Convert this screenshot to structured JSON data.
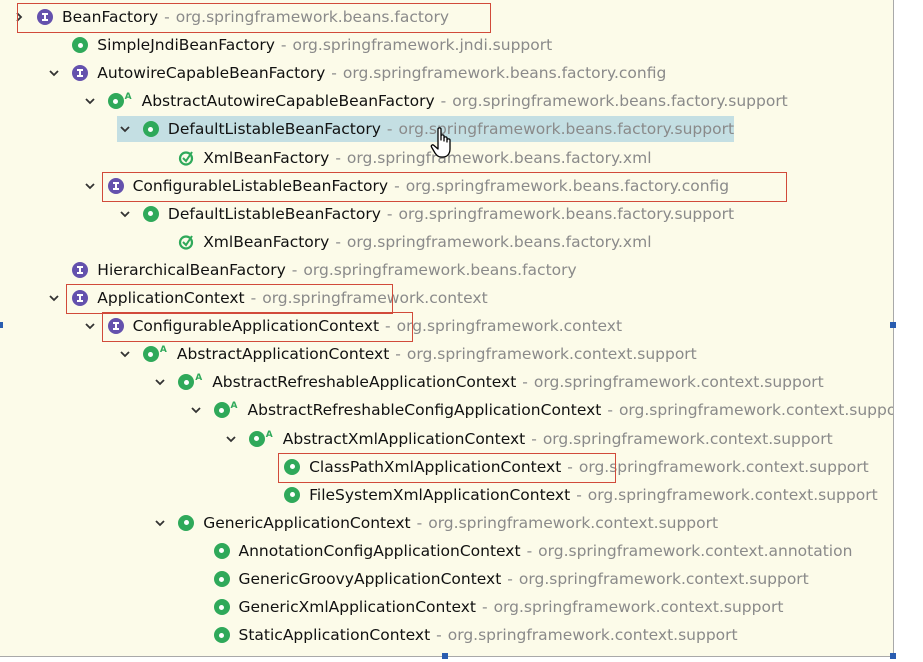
{
  "tree": {
    "rows": [
      {
        "name": "BeanFactory",
        "pkg": "org.springframework.beans.factory"
      },
      {
        "name": "SimpleJndiBeanFactory",
        "pkg": "org.springframework.jndi.support"
      },
      {
        "name": "AutowireCapableBeanFactory",
        "pkg": "org.springframework.beans.factory.config"
      },
      {
        "name": "AbstractAutowireCapableBeanFactory",
        "pkg": "org.springframework.beans.factory.support"
      },
      {
        "name": "DefaultListableBeanFactory",
        "pkg": "org.springframework.beans.factory.support"
      },
      {
        "name": "XmlBeanFactory",
        "pkg": "org.springframework.beans.factory.xml"
      },
      {
        "name": "ConfigurableListableBeanFactory",
        "pkg": "org.springframework.beans.factory.config"
      },
      {
        "name": "DefaultListableBeanFactory",
        "pkg": "org.springframework.beans.factory.support"
      },
      {
        "name": "XmlBeanFactory",
        "pkg": "org.springframework.beans.factory.xml"
      },
      {
        "name": "HierarchicalBeanFactory",
        "pkg": "org.springframework.beans.factory"
      },
      {
        "name": "ApplicationContext",
        "pkg": "org.springframework.context"
      },
      {
        "name": "ConfigurableApplicationContext",
        "pkg": "org.springframework.context"
      },
      {
        "name": "AbstractApplicationContext",
        "pkg": "org.springframework.context.support"
      },
      {
        "name": "AbstractRefreshableApplicationContext",
        "pkg": "org.springframework.context.support"
      },
      {
        "name": "AbstractRefreshableConfigApplicationContext",
        "pkg": "org.springframework.context.support"
      },
      {
        "name": "AbstractXmlApplicationContext",
        "pkg": "org.springframework.context.support"
      },
      {
        "name": "ClassPathXmlApplicationContext",
        "pkg": "org.springframework.context.support"
      },
      {
        "name": "FileSystemXmlApplicationContext",
        "pkg": "org.springframework.context.support"
      },
      {
        "name": "GenericApplicationContext",
        "pkg": "org.springframework.context.support"
      },
      {
        "name": "AnnotationConfigApplicationContext",
        "pkg": "org.springframework.context.annotation"
      },
      {
        "name": "GenericGroovyApplicationContext",
        "pkg": "org.springframework.context.support"
      },
      {
        "name": "GenericXmlApplicationContext",
        "pkg": "org.springframework.context.support"
      },
      {
        "name": "StaticApplicationContext",
        "pkg": "org.springframework.context.support"
      }
    ],
    "separator": "-"
  },
  "colors": {
    "background": "#fcfbe9",
    "selection": "#c4dfe3",
    "highlight_box": "#d14a3a",
    "interface_icon": "#6451ad",
    "class_icon": "#2fa95a"
  }
}
